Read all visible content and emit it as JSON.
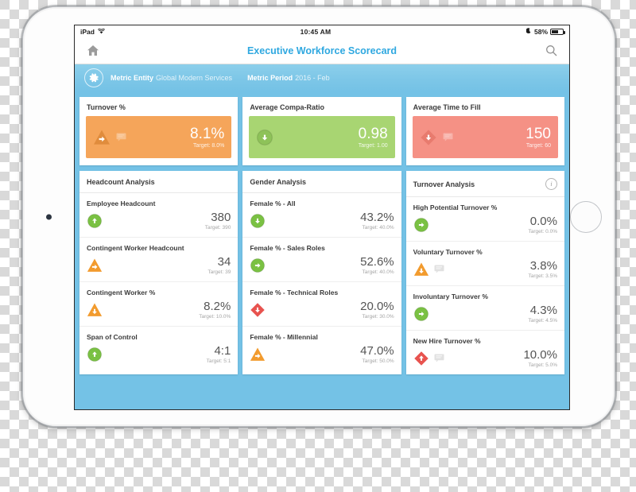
{
  "status_bar": {
    "carrier": "iPad",
    "wifi_icon": "wifi-icon",
    "time": "10:45 AM",
    "alarm_icon": "moon-icon",
    "battery_percent": "58%"
  },
  "nav_bar": {
    "home_icon": "home-icon",
    "title": "Executive Workforce Scorecard",
    "search_icon": "search-icon"
  },
  "filter_bar": {
    "gear_icon": "gear-icon",
    "filters": [
      {
        "label": "Metric Entity",
        "value": "Global Modern Services"
      },
      {
        "label": "Metric Period",
        "value": "2016 - Feb"
      }
    ]
  },
  "colors": {
    "accent_blue": "#2fa8e0",
    "band_blue": "#74c2e6",
    "orange": "#f5a55a",
    "green": "#a8d572",
    "salmon": "#f59185",
    "icon_green": "#7ac143",
    "icon_orange": "#f29b2e",
    "icon_red": "#e8534f"
  },
  "kpis": [
    {
      "title": "Turnover %",
      "value": "8.1%",
      "target": "Target: 8.0%",
      "band_color": "#f5a55a",
      "indicator": {
        "shape": "triangle",
        "direction": "right",
        "color": "#e08c3c"
      },
      "has_comment": true
    },
    {
      "title": "Average Compa-Ratio",
      "value": "0.98",
      "target": "Target: 1.00",
      "band_color": "#a8d572",
      "indicator": {
        "shape": "circle",
        "direction": "down",
        "color": "#8ec259"
      },
      "has_comment": false
    },
    {
      "title": "Average Time to Fill",
      "value": "150",
      "target": "Target: 60",
      "band_color": "#f59185",
      "indicator": {
        "shape": "diamond",
        "direction": "down",
        "color": "#e87b6e"
      },
      "has_comment": true
    }
  ],
  "panels": [
    {
      "title": "Headcount Analysis",
      "has_info": false,
      "metrics": [
        {
          "label": "Employee Headcount",
          "value": "380",
          "target": "Target: 390",
          "indicator": {
            "shape": "circle",
            "direction": "up",
            "color": "#7ac143"
          },
          "has_comment": false
        },
        {
          "label": "Contingent Worker Headcount",
          "value": "34",
          "target": "Target: 39",
          "indicator": {
            "shape": "triangle",
            "direction": "right",
            "color": "#f29b2e"
          },
          "has_comment": false
        },
        {
          "label": "Contingent Worker %",
          "value": "8.2%",
          "target": "Target: 10.0%",
          "indicator": {
            "shape": "triangle",
            "direction": "down",
            "color": "#f29b2e"
          },
          "has_comment": false
        },
        {
          "label": "Span of Control",
          "value": "4:1",
          "target": "Target: 5:1",
          "indicator": {
            "shape": "circle",
            "direction": "up",
            "color": "#7ac143"
          },
          "has_comment": false
        }
      ]
    },
    {
      "title": "Gender Analysis",
      "has_info": false,
      "metrics": [
        {
          "label": "Female % - All",
          "value": "43.2%",
          "target": "Target: 40.0%",
          "indicator": {
            "shape": "circle",
            "direction": "down",
            "color": "#7ac143"
          },
          "has_comment": false
        },
        {
          "label": "Female % - Sales Roles",
          "value": "52.6%",
          "target": "Target: 40.0%",
          "indicator": {
            "shape": "circle",
            "direction": "right",
            "color": "#7ac143"
          },
          "has_comment": false
        },
        {
          "label": "Female % - Technical Roles",
          "value": "20.0%",
          "target": "Target: 30.0%",
          "indicator": {
            "shape": "diamond",
            "direction": "down",
            "color": "#e8534f"
          },
          "has_comment": false
        },
        {
          "label": "Female % - Millennial",
          "value": "47.0%",
          "target": "Target: 50.0%",
          "indicator": {
            "shape": "triangle",
            "direction": "right",
            "color": "#f29b2e"
          },
          "has_comment": false
        }
      ]
    },
    {
      "title": "Turnover Analysis",
      "has_info": true,
      "info_icon": "info-icon",
      "metrics": [
        {
          "label": "High Potential Turnover %",
          "value": "0.0%",
          "target": "Target: 0.0%",
          "indicator": {
            "shape": "circle",
            "direction": "right",
            "color": "#7ac143"
          },
          "has_comment": false
        },
        {
          "label": "Voluntary Turnover %",
          "value": "3.8%",
          "target": "Target: 3.5%",
          "indicator": {
            "shape": "triangle",
            "direction": "down",
            "color": "#f29b2e"
          },
          "has_comment": true
        },
        {
          "label": "Involuntary Turnover %",
          "value": "4.3%",
          "target": "Target: 4.5%",
          "indicator": {
            "shape": "circle",
            "direction": "right",
            "color": "#7ac143"
          },
          "has_comment": false
        },
        {
          "label": "New Hire Turnover %",
          "value": "10.0%",
          "target": "Target: 5.0%",
          "indicator": {
            "shape": "diamond",
            "direction": "up",
            "color": "#e8534f"
          },
          "has_comment": true
        }
      ]
    }
  ]
}
